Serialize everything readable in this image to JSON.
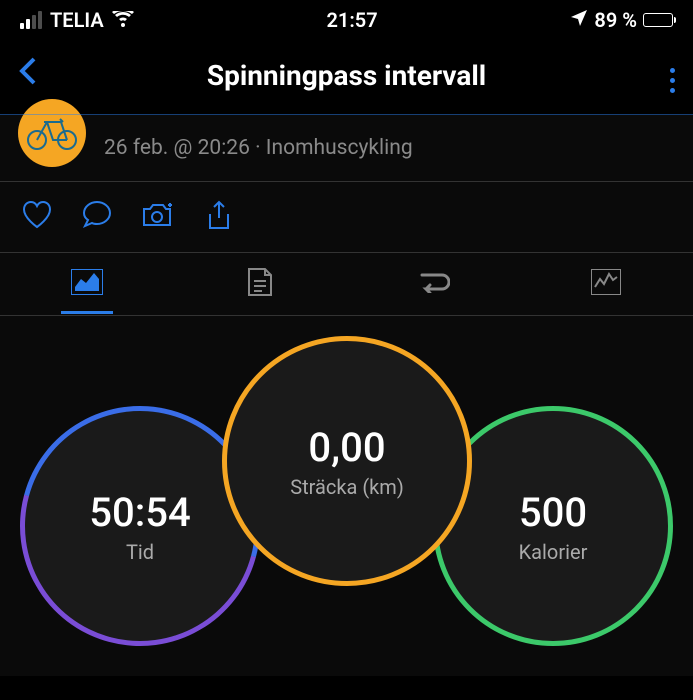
{
  "status": {
    "carrier": "TELIA",
    "time": "21:57",
    "battery_pct": "89 %"
  },
  "header": {
    "title": "Spinningpass intervall"
  },
  "activity": {
    "meta": "26 feb. @ 20:26 · Inomhuscykling"
  },
  "metrics": {
    "time": {
      "value": "50:54",
      "label": "Tid"
    },
    "distance": {
      "value": "0,00",
      "label": "Sträcka (km)"
    },
    "calories": {
      "value": "500",
      "label": "Kalorier"
    }
  }
}
